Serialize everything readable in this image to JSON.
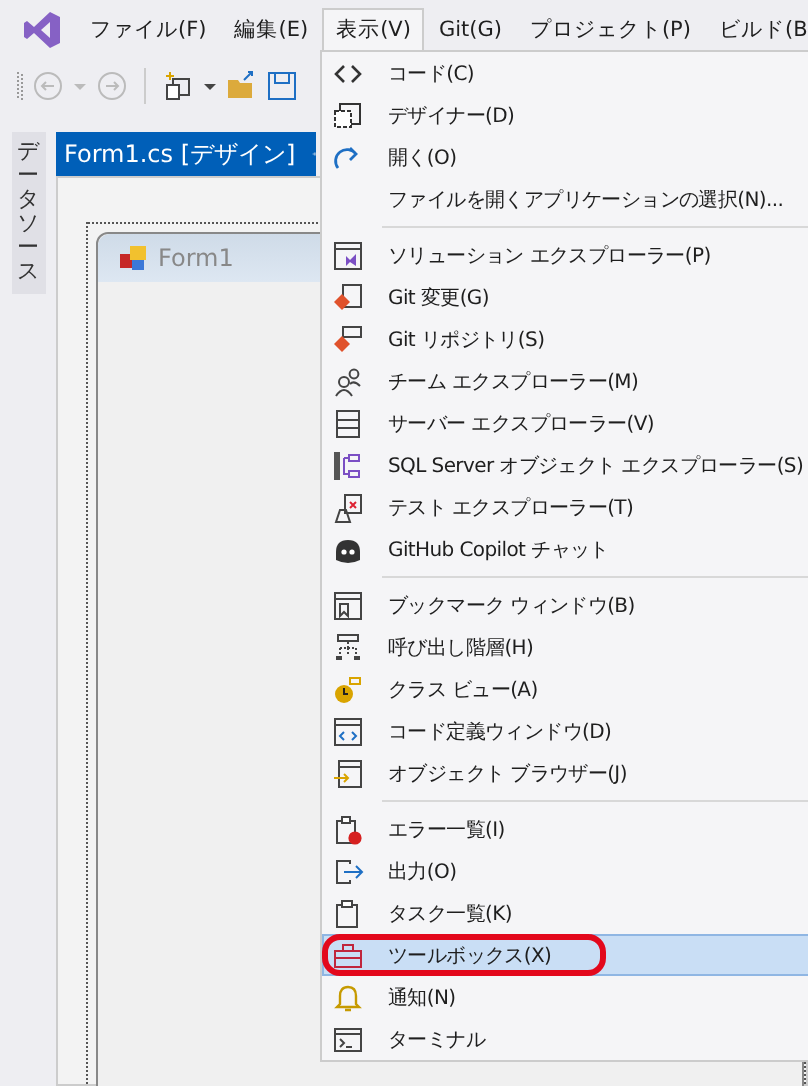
{
  "menubar": [
    {
      "label": "ファイル(F)",
      "selected": false
    },
    {
      "label": "編集(E)",
      "selected": false
    },
    {
      "label": "表示(V)",
      "selected": true
    },
    {
      "label": "Git(G)",
      "selected": false
    },
    {
      "label": "プロジェクト(P)",
      "selected": false
    },
    {
      "label": "ビルド(B",
      "selected": false
    }
  ],
  "side_tab": {
    "label": "データソース"
  },
  "document_tab": {
    "title": "Form1.cs [デザイン]"
  },
  "designer": {
    "form_title": "Form1"
  },
  "view_menu": [
    {
      "kind": "item",
      "label": "コード(C)",
      "selected": false
    },
    {
      "kind": "item",
      "label": "デザイナー(D)",
      "selected": false
    },
    {
      "kind": "item",
      "label": "開く(O)",
      "selected": false
    },
    {
      "kind": "item",
      "label": "ファイルを開くアプリケーションの選択(N)...",
      "selected": false
    },
    {
      "kind": "separator"
    },
    {
      "kind": "item",
      "label": "ソリューション エクスプローラー(P)",
      "selected": false
    },
    {
      "kind": "item",
      "label": "Git 変更(G)",
      "selected": false
    },
    {
      "kind": "item",
      "label": "Git リポジトリ(S)",
      "selected": false
    },
    {
      "kind": "item",
      "label": "チーム エクスプローラー(M)",
      "selected": false
    },
    {
      "kind": "item",
      "label": "サーバー エクスプローラー(V)",
      "selected": false
    },
    {
      "kind": "item",
      "label": "SQL Server オブジェクト エクスプローラー(S)",
      "selected": false
    },
    {
      "kind": "item",
      "label": "テスト エクスプローラー(T)",
      "selected": false
    },
    {
      "kind": "item",
      "label": "GitHub Copilot チャット",
      "selected": false
    },
    {
      "kind": "separator"
    },
    {
      "kind": "item",
      "label": "ブックマーク ウィンドウ(B)",
      "selected": false
    },
    {
      "kind": "item",
      "label": "呼び出し階層(H)",
      "selected": false
    },
    {
      "kind": "item",
      "label": "クラス ビュー(A)",
      "selected": false
    },
    {
      "kind": "item",
      "label": "コード定義ウィンドウ(D)",
      "selected": false
    },
    {
      "kind": "item",
      "label": "オブジェクト ブラウザー(J)",
      "selected": false
    },
    {
      "kind": "separator"
    },
    {
      "kind": "item",
      "label": "エラー一覧(I)",
      "selected": false
    },
    {
      "kind": "item",
      "label": "出力(O)",
      "selected": false
    },
    {
      "kind": "item",
      "label": "タスク一覧(K)",
      "selected": false
    },
    {
      "kind": "item",
      "label": "ツールボックス(X)",
      "selected": true
    },
    {
      "kind": "item",
      "label": "通知(N)",
      "selected": false
    },
    {
      "kind": "item",
      "label": "ターミナル",
      "selected": false
    }
  ]
}
